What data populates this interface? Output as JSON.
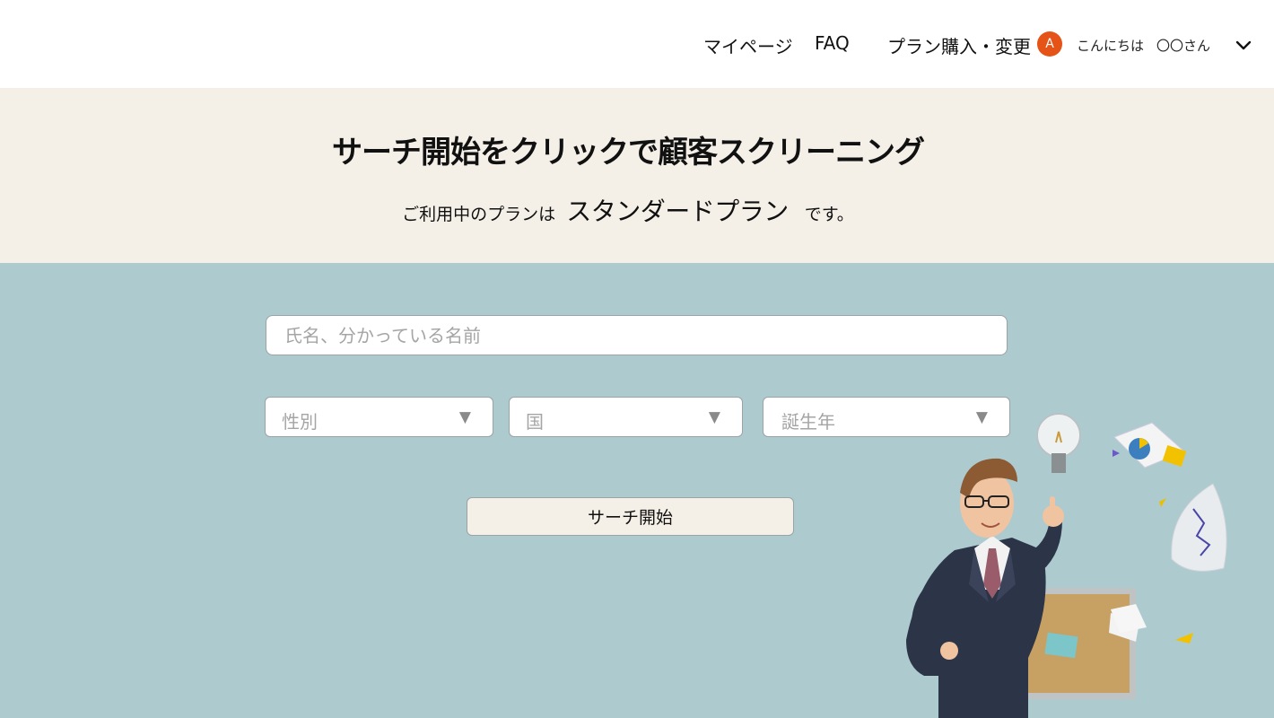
{
  "header": {
    "nav": [
      "マイページ",
      "FAQ",
      "プラン購入・変更"
    ],
    "avatar_letter": "A",
    "greeting": "こんにちは",
    "user_name": "〇〇さん",
    "avatar_color": "#e55316"
  },
  "hero": {
    "title": "サーチ開始をクリックで顧客スクリーニング",
    "plan_prefix": "ご利用中のプランは",
    "plan_name": "スタンダードプラン",
    "plan_suffix": "です。",
    "background": "#f4efe7"
  },
  "search": {
    "name_placeholder": "氏名、分かっている名前",
    "gender_placeholder": "性別",
    "country_placeholder": "国",
    "birth_year_placeholder": "誕生年",
    "dropdown_arrow": "▼",
    "submit_label": "サーチ開始",
    "background": "#adcacf"
  },
  "icons": {
    "user_menu": "chevron-down-icon",
    "illustration": "businessman-idea-illustration"
  }
}
